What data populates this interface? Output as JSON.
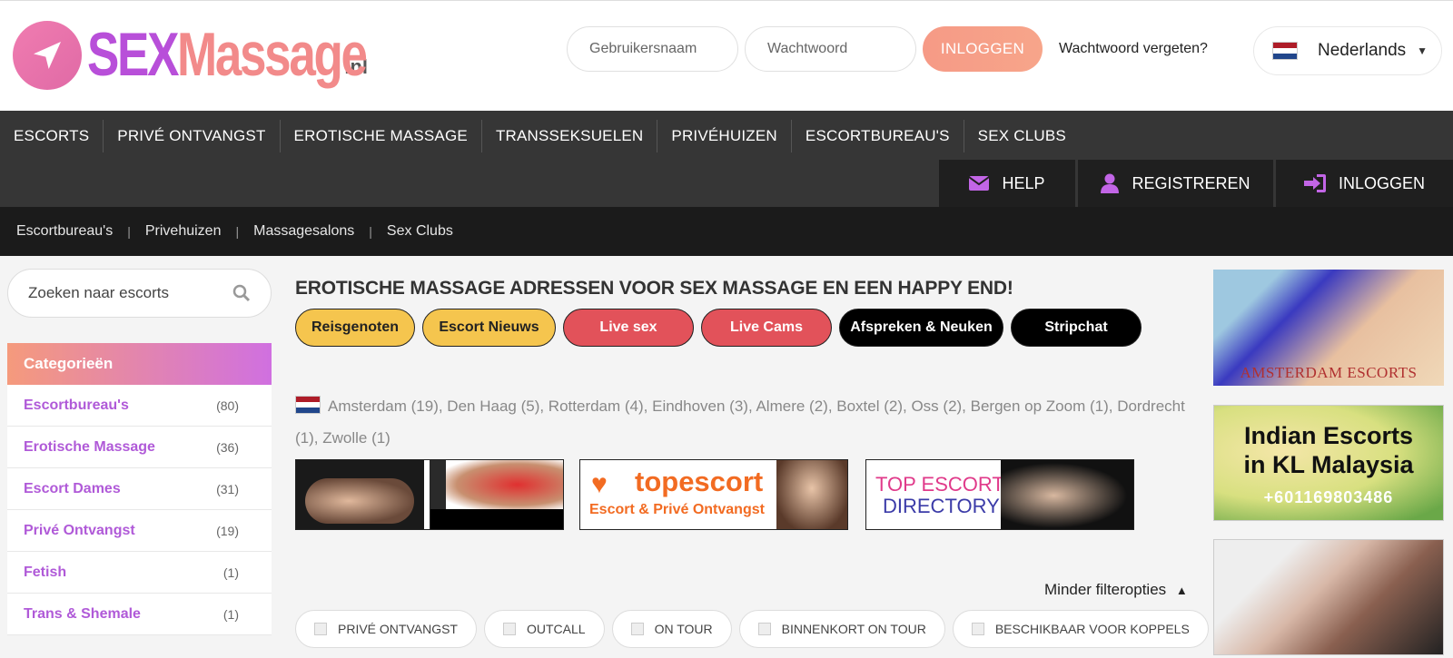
{
  "logo": {
    "part1": "SEX",
    "part2": "Massage",
    "tld": ".nl"
  },
  "login": {
    "username_placeholder": "Gebruikersnaam",
    "password_placeholder": "Wachtwoord",
    "button": "INLOGGEN",
    "forgot": "Wachtwoord vergeten?"
  },
  "language": {
    "selected": "Nederlands"
  },
  "nav": {
    "items": [
      "ESCORTS",
      "PRIVÉ ONTVANGST",
      "EROTISCHE MASSAGE",
      "TRANSSEKSUELEN",
      "PRIVÉHUIZEN",
      "ESCORTBUREAU'S",
      "SEX CLUBS"
    ],
    "help": "HELP",
    "register": "REGISTREREN",
    "login": "INLOGGEN"
  },
  "subnav": [
    "Escortbureau's",
    "Privehuizen",
    "Massagesalons",
    "Sex Clubs"
  ],
  "search": {
    "placeholder": "Zoeken naar escorts"
  },
  "categories": {
    "title": "Categorieën",
    "items": [
      {
        "label": "Escortbureau's",
        "count": "(80)"
      },
      {
        "label": "Erotische Massage",
        "count": "(36)"
      },
      {
        "label": "Escort Dames",
        "count": "(31)"
      },
      {
        "label": "Privé Ontvangst",
        "count": "(19)"
      },
      {
        "label": "Fetish",
        "count": "(1)"
      },
      {
        "label": "Trans & Shemale",
        "count": "(1)"
      }
    ]
  },
  "main": {
    "title": "EROTISCHE MASSAGE ADRESSEN VOOR SEX MASSAGE EN EEN HAPPY END!",
    "pills": [
      "Reisgenoten",
      "Escort Nieuws",
      "Live sex",
      "Live Cams",
      "Afspreken & Neuken",
      "Stripchat"
    ],
    "cities": "Amsterdam (19), Den Haag (5), Rotterdam (4), Eindhoven (3), Almere (2), Boxtel (2), Oss (2), Bergen op Zoom (1), Dordrecht (1), Zwolle (1)",
    "less_filters": "Minder filteropties",
    "filters": [
      "PRIVÉ ONTVANGST",
      "OUTCALL",
      "ON TOUR",
      "BINNENKORT ON TOUR",
      "BESCHIKBAAR VOOR KOPPELS"
    ]
  },
  "banners": {
    "topescort_title": "topescort",
    "topescort_sub": "Escort & Privé Ontvangst",
    "directory_line1": "TOP ESCORT",
    "directory_line2": "DIRECTORY"
  },
  "ads": {
    "ad1_caption": "AMSTERDAM ESCORTS",
    "ad2_line1": "Indian Escorts",
    "ad2_line2": "in KL Malaysia",
    "ad2_phone": "+601169803486"
  },
  "colors": {
    "accent_purple": "#b05ad8",
    "accent_orange": "#f69a86",
    "nav_bg": "#363636"
  }
}
